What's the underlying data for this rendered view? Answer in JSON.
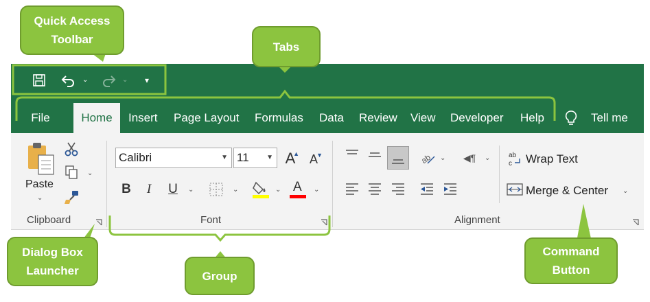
{
  "quick_access": {
    "save_icon": "save-icon",
    "undo_icon": "undo-icon",
    "redo_icon": "redo-icon",
    "customize_icon": "customize-qat-icon"
  },
  "tabs": [
    "File",
    "Home",
    "Insert",
    "Page Layout",
    "Formulas",
    "Data",
    "Review",
    "View",
    "Developer",
    "Help"
  ],
  "tell_me": "Tell me",
  "clipboard": {
    "paste_label": "Paste",
    "group_label": "Clipboard"
  },
  "font": {
    "name": "Calibri",
    "size": "11",
    "group_label": "Font",
    "bold": "B",
    "italic": "I",
    "underline": "U",
    "grow": "A",
    "shrink": "A",
    "font_color_letter": "A"
  },
  "alignment": {
    "wrap_text": "Wrap Text",
    "merge_center": "Merge & Center",
    "group_label": "Alignment"
  },
  "callouts": {
    "quick_access": [
      "Quick Access",
      "Toolbar"
    ],
    "tabs": "Tabs",
    "dialog_box": [
      "Dialog Box",
      "Launcher"
    ],
    "group": "Group",
    "command": [
      "Command",
      "Button"
    ]
  },
  "colors": {
    "excel_green": "#217346",
    "callout_green": "#8cc43f",
    "highlight_yellow": "#ffff00",
    "font_red": "#ff0000"
  }
}
